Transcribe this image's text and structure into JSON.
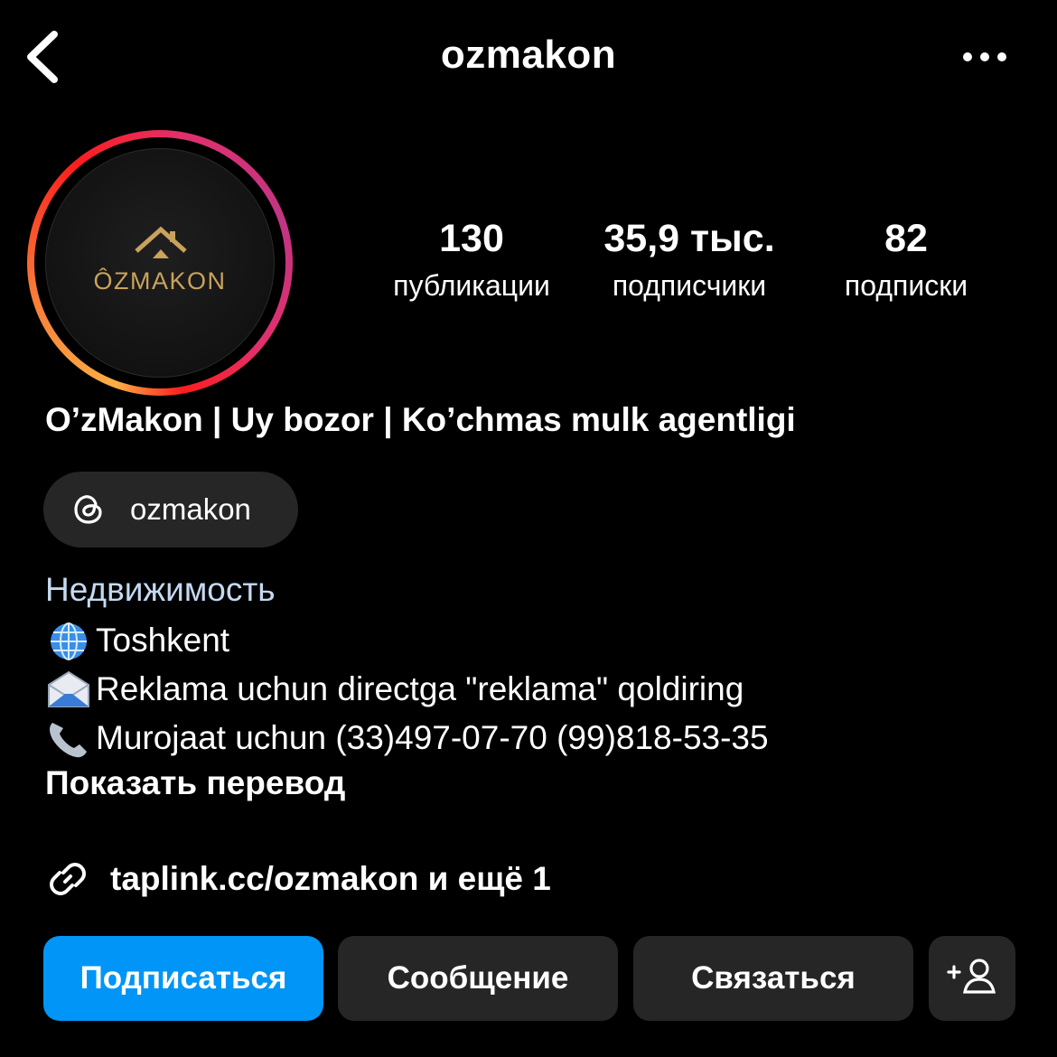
{
  "header": {
    "username": "ozmakon",
    "back_icon": "chevron-left-icon",
    "more_icon": "more-horizontal-icon"
  },
  "avatar": {
    "logo_text": "ÔZMAKON",
    "logo_icon": "house-roof-icon",
    "colors": {
      "logo_gold": "#c9a35c"
    }
  },
  "stats": [
    {
      "value": "130",
      "label": "публикации"
    },
    {
      "value": "35,9 тыс.",
      "label": "подписчики"
    },
    {
      "value": "82",
      "label": "подписки"
    }
  ],
  "profile": {
    "full_name": "O’zMakon | Uy bozor | Ko’chmas mulk agentligi",
    "threads_handle": "ozmakon",
    "category": "Недвижимость",
    "bio_lines": [
      {
        "icon": "globe-icon",
        "text": "Toshkent"
      },
      {
        "icon": "envelope-icon",
        "text": "Reklama uchun directga \"reklama\" qoldiring"
      },
      {
        "icon": "telephone-icon",
        "text": "Murojaat uchun (33)497-07-70 (99)818-53-35"
      }
    ],
    "show_translation": "Показать перевод",
    "link": "taplink.cc/ozmakon и ещё 1"
  },
  "actions": {
    "follow": "Подписаться",
    "message": "Сообщение",
    "contact": "Связаться",
    "add_person_icon": "add-person-icon"
  },
  "colors": {
    "background": "#000000",
    "primary_button": "#0095f6",
    "secondary_button": "#262626",
    "category_text": "#c5d9f1"
  }
}
